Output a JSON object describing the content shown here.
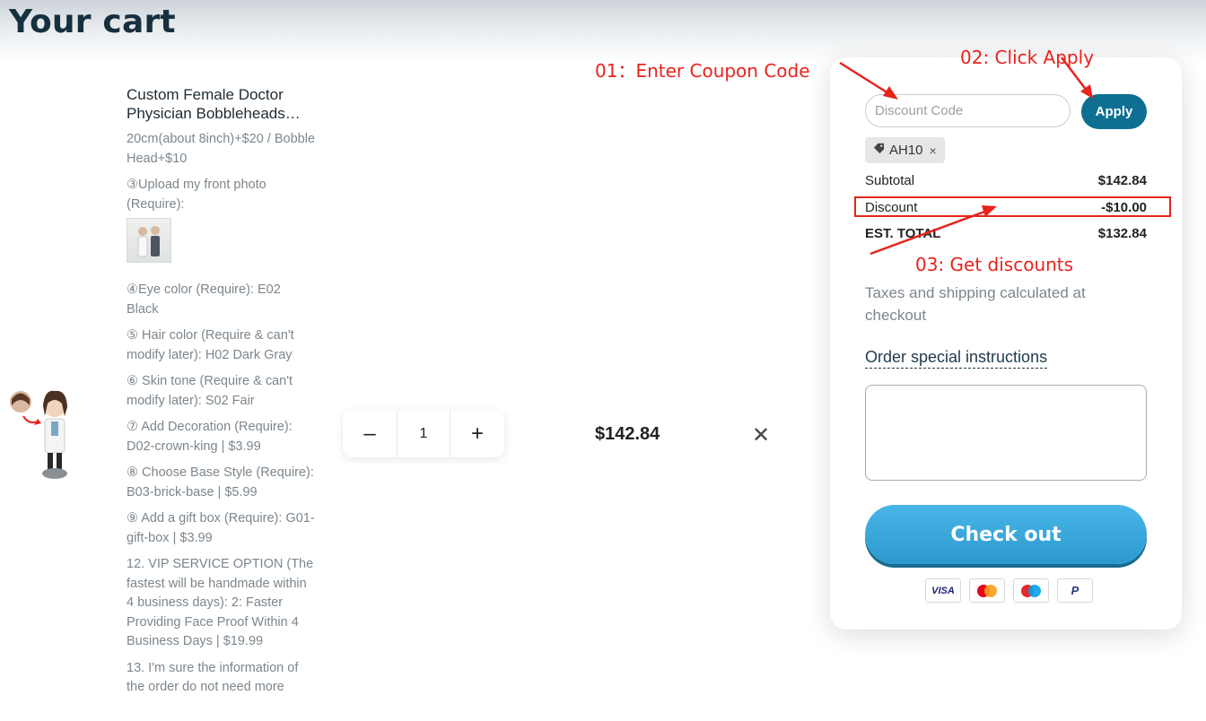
{
  "page": {
    "title": "Your cart"
  },
  "product": {
    "name": "Custom Female Doctor Physician Bobbleheads With Engraved Text",
    "options": [
      "20cm(about 8inch)+$20 / Bobble Head+$10",
      "③Upload my front photo (Require):",
      "④Eye color (Require): E02 Black",
      "⑤ Hair color (Require & can't modify later): H02 Dark Gray",
      "⑥ Skin tone (Require & can't modify later): S02 Fair",
      "⑦ Add Decoration (Require): D02-crown-king | $3.99",
      "⑧ Choose Base Style (Require): B03-brick-base | $5.99",
      "⑨ Add a gift box (Require): G01-gift-box | $3.99",
      "12. VIP SERVICE OPTION (The fastest will be handmade within 4 business days): 2: Faster Providing Face Proof Within 4 Business Days | $19.99",
      "13. I'm sure the information of the order do not need more"
    ],
    "quantity": "1",
    "minus": "–",
    "plus": "+",
    "line_price": "$142.84",
    "remove": "✕"
  },
  "summary": {
    "discount_placeholder": "Discount Code",
    "apply_label": "Apply",
    "coupon": "AH10",
    "coupon_remove": "×",
    "subtotal_label": "Subtotal",
    "subtotal": "$142.84",
    "discount_label": "Discount",
    "discount": "-$10.00",
    "total_label": "EST. TOTAL",
    "total": "$132.84",
    "tax_note": "Taxes and shipping calculated at checkout",
    "instructions_label": "Order special instructions",
    "checkout_label": "Check out",
    "payment_methods": [
      "VISA",
      "mastercard",
      "maestro",
      "paypal"
    ]
  },
  "annotations": {
    "step1": "01：Enter Coupon Code",
    "step2": "02: Click Apply",
    "step3": "03: Get discounts"
  },
  "colors": {
    "accent": "#0e6f92",
    "checkout": "#3aa7dc",
    "annotation": "#e8231c"
  }
}
